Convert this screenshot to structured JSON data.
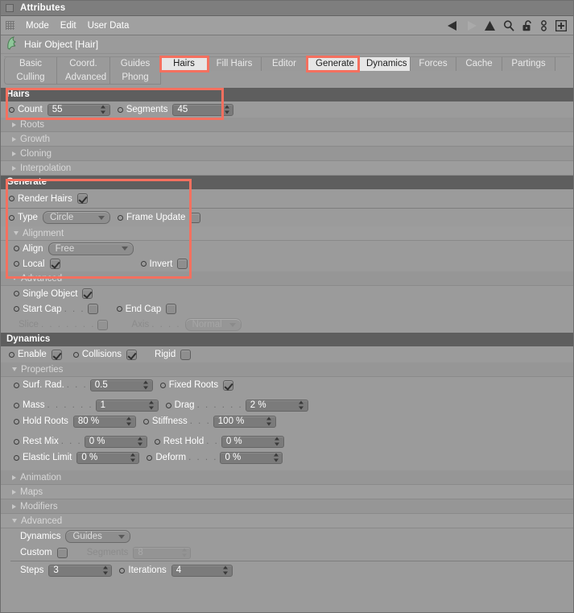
{
  "window": {
    "title": "Attributes"
  },
  "menubar": {
    "items": [
      "Mode",
      "Edit",
      "User Data"
    ],
    "tools": [
      "back-arrow-icon",
      "forward-arrow-icon",
      "up-arrow-icon",
      "search-icon",
      "lock-icon",
      "chain-icon",
      "add-icon"
    ]
  },
  "object": {
    "icon": "hair-object-icon",
    "title": "Hair Object [Hair]"
  },
  "tabs": {
    "row1": [
      {
        "label": "Basic",
        "state": "normal"
      },
      {
        "label": "Coord.",
        "state": "normal"
      },
      {
        "label": "Guides",
        "state": "normal"
      },
      {
        "label": "Hairs",
        "state": "selected",
        "highlight": true
      },
      {
        "label": "Fill Hairs",
        "state": "normal"
      },
      {
        "label": "Editor",
        "state": "normal"
      },
      {
        "label": "Generate",
        "state": "selected",
        "highlight": true
      },
      {
        "label": "Dynamics",
        "state": "selected"
      },
      {
        "label": "Forces",
        "state": "normal"
      },
      {
        "label": "Cache",
        "state": "normal"
      },
      {
        "label": "Partings",
        "state": "normal"
      }
    ],
    "row2": [
      {
        "label": "Culling",
        "state": "normal"
      },
      {
        "label": "Advanced",
        "state": "normal"
      },
      {
        "label": "Phong",
        "state": "normal"
      }
    ]
  },
  "highlight_color": "#f4705f",
  "sections": {
    "hairs": {
      "header": "Hairs",
      "count_label": "Count",
      "count_value": "55",
      "segments_label": "Segments",
      "segments_value": "45",
      "folds": [
        "Roots",
        "Growth",
        "Cloning",
        "Interpolation"
      ]
    },
    "generate": {
      "header": "Generate",
      "render_hairs_label": "Render Hairs",
      "render_hairs_checked": true,
      "type_label": "Type",
      "type_value": "Circle",
      "frame_update_label": "Frame Update",
      "frame_update_checked": false,
      "alignment_fold": "Alignment",
      "align_label": "Align",
      "align_value": "Free",
      "local_label": "Local",
      "local_checked": true,
      "invert_label": "Invert",
      "invert_checked": false
    },
    "advanced_generate": {
      "fold": "Advanced",
      "single_object_label": "Single Object",
      "single_object_checked": true,
      "start_cap_label": "Start Cap",
      "start_cap_dots": ". . .",
      "start_cap_checked": false,
      "end_cap_label": "End Cap",
      "end_cap_checked": false,
      "slice_label": "Slice",
      "slice_dots": ". . . . . . .",
      "slice_checked": false,
      "axis_label": "Axis",
      "axis_dots": ". . . .",
      "axis_value": "Normal"
    },
    "dynamics": {
      "header": "Dynamics",
      "enable_label": "Enable",
      "enable_checked": true,
      "collisions_label": "Collisions",
      "collisions_checked": true,
      "rigid_label": "Rigid",
      "rigid_checked": false,
      "properties_fold": "Properties",
      "properties": [
        {
          "label": "Surf. Rad.",
          "dots": ". . .",
          "value": "0.5"
        },
        {
          "label": "Mass",
          "dots": ". . . . . .",
          "value": "1"
        },
        {
          "label": "Hold Roots",
          "dots": "",
          "value": "80 %"
        },
        {
          "label": "Rest Mix",
          "dots": ". . .",
          "value": "0 %"
        },
        {
          "label": "Elastic Limit",
          "dots": "",
          "value": "0 %"
        }
      ],
      "fixed_roots_label": "Fixed Roots",
      "fixed_roots_checked": true,
      "properties_right": [
        {
          "label": "Drag",
          "dots": ". . . . . .",
          "value": "2 %"
        },
        {
          "label": "Stiffness",
          "dots": ". . .",
          "value": "100 %"
        },
        {
          "label": "Rest Hold",
          "dots": ". .",
          "value": "0 %"
        },
        {
          "label": "Deform",
          "dots": ". . . .",
          "value": "0 %"
        }
      ],
      "folds": [
        "Animation",
        "Maps",
        "Modifiers"
      ],
      "advanced_fold": "Advanced",
      "dynamics_label": "Dynamics",
      "dynamics_value": "Guides",
      "custom_label": "Custom",
      "custom_checked": false,
      "segments_label": "Segments",
      "segments_value": "8",
      "steps_label": "Steps",
      "steps_value": "3",
      "iterations_label": "Iterations",
      "iterations_value": "4"
    }
  }
}
